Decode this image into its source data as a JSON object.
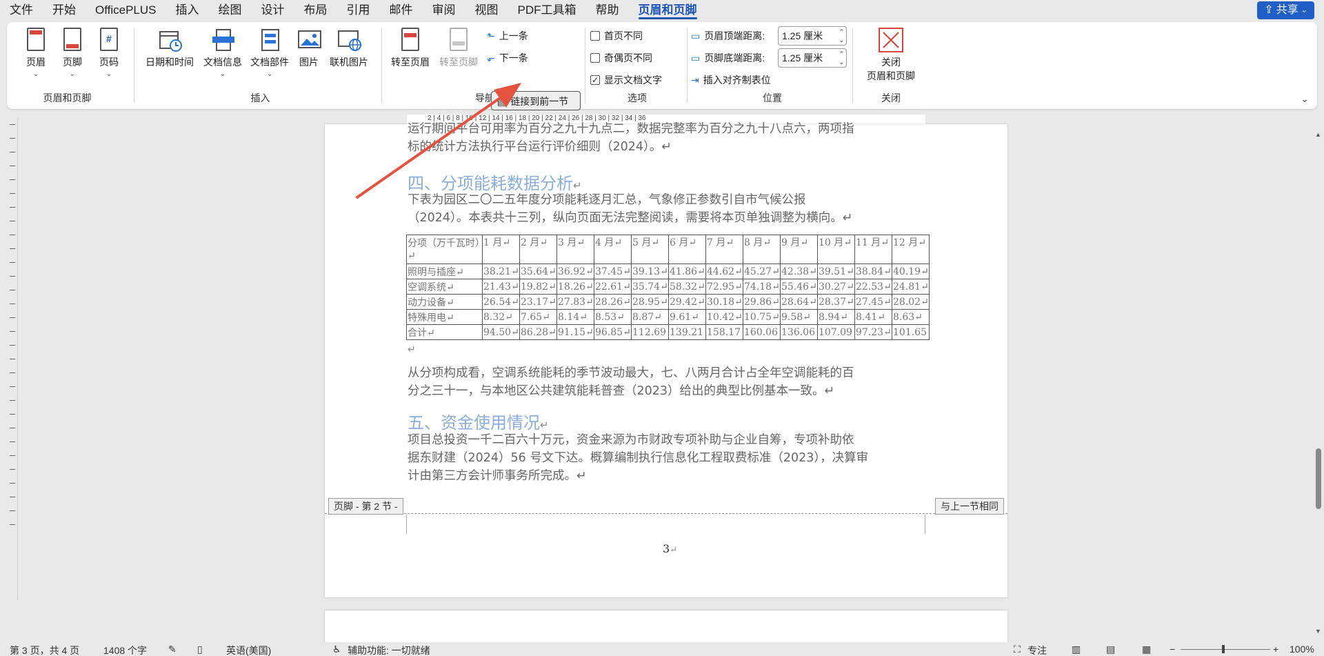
{
  "menu": {
    "items": [
      "文件",
      "开始",
      "OfficePLUS",
      "插入",
      "绘图",
      "设计",
      "布局",
      "引用",
      "邮件",
      "审阅",
      "视图",
      "PDF工具箱",
      "帮助",
      "页眉和页脚"
    ],
    "share": "共享"
  },
  "ribbon": {
    "hf_group": {
      "label": "页眉和页脚",
      "header": "页眉",
      "footer": "页脚",
      "pagenum": "页码"
    },
    "insert_group": {
      "label": "插入",
      "datetime": "日期和时间",
      "docinfo": "文档信息",
      "docparts": "文档部件",
      "picture": "图片",
      "online_picture": "联机图片"
    },
    "nav_group": {
      "label": "导航",
      "goto_header": "转至页眉",
      "goto_footer": "转至页脚",
      "prev": "上一条",
      "next": "下一条",
      "link_prev": "链接到前一节"
    },
    "options_group": {
      "label": "选项",
      "first_diff": "首页不同",
      "odd_even_diff": "奇偶页不同",
      "show_doc_text": "显示文档文字"
    },
    "position_group": {
      "label": "位置",
      "header_top": "页眉顶端距离:",
      "header_top_value": "1.25 厘米",
      "footer_bottom": "页脚底端距离:",
      "footer_bottom_value": "1.25 厘米",
      "insert_align_tab": "插入对齐制表位"
    },
    "close_group": {
      "label": "关闭",
      "close": "关闭",
      "close2": "页眉和页脚"
    }
  },
  "ruler": {
    "labels": "2 | 4 | 6 | 8 | 10 | 12 | 14 | 16 | 18 | 20 | 22 | 24 | 26 | 28 | 30 | 32 | 34 | 36"
  },
  "document": {
    "cut_top_1": "运行期间平台可用率为百分之九十九点二，数据完整率为百分之九十八点六，两项指",
    "cut_top_2": "标的统计方法执行平台运行评价细则（2024）。↵",
    "heading4": "四、分项能耗数据分析",
    "para_intro_1": "下表为园区二〇二五年度分项能耗逐月汇总，气象修正参数引自市气候公报",
    "para_intro_2": "（2024）。本表共十三列，纵向页面无法完整阅读，需要将本页单独调整为横向。↵",
    "table": {
      "header": [
        "分项（万千瓦时）↵",
        "1 月↵",
        "2 月↵",
        "3 月↵",
        "4 月↵",
        "5 月↵",
        "6 月↵",
        "7 月↵",
        "8 月↵",
        "9 月↵",
        "10 月↵",
        "11 月↵",
        "12 月↵"
      ],
      "rows": [
        [
          "照明与插座↵",
          "38.21↵",
          "35.64↵",
          "36.92↵",
          "37.45↵",
          "39.13↵",
          "41.86↵",
          "44.62↵",
          "45.27↵",
          "42.38↵",
          "39.51↵",
          "38.84↵",
          "40.19↵"
        ],
        [
          "空调系统↵",
          "21.43↵",
          "19.82↵",
          "18.26↵",
          "22.61↵",
          "35.74↵",
          "58.32↵",
          "72.95↵",
          "74.18↵",
          "55.46↵",
          "30.27↵",
          "22.53↵",
          "24.81↵"
        ],
        [
          "动力设备↵",
          "26.54↵",
          "23.17↵",
          "27.83↵",
          "28.26↵",
          "28.95↵",
          "29.42↵",
          "30.18↵",
          "29.86↵",
          "28.64↵",
          "28.37↵",
          "27.45↵",
          "28.02↵"
        ],
        [
          "特殊用电↵",
          "8.32↵",
          "7.65↵",
          "8.14↵",
          "8.53↵",
          "8.87↵",
          "9.61↵",
          "10.42↵",
          "10.75↵",
          "9.58↵",
          "8.94↵",
          "8.41↵",
          "8.63↵"
        ],
        [
          "合计↵",
          "94.50↵",
          "86.28↵",
          "91.15↵",
          "96.85↵",
          "112.69",
          "139.21",
          "158.17",
          "160.06",
          "136.06",
          "107.09",
          "97.23↵",
          "101.65"
        ]
      ]
    },
    "empty_para": "↵",
    "para_analysis_1": "从分项构成看，空调系统能耗的季节波动最大，七、八两月合计占全年空调能耗的百",
    "para_analysis_2": "分之三十一，与本地区公共建筑能耗普查（2023）给出的典型比例基本一致。↵",
    "heading5": "五、资金使用情况",
    "para_fund_1": "项目总投资一千二百六十万元，资金来源为市财政专项补助与企业自筹，专项补助依",
    "para_fund_2": "据东财建（2024）56 号文下达。概算编制执行信息化工程取费标准（2023），决算审",
    "para_fund_3": "计由第三方会计师事务所完成。↵",
    "footer_tag": "页脚 - 第 2 节 -",
    "same_as_prev": "与上一节相同",
    "page_number": "3"
  },
  "status": {
    "page": "第 3 页，共 4 页",
    "words": "1408 个字",
    "language": "英语(美国)",
    "accessibility": "辅助功能: 一切就绪",
    "focus": "专注",
    "zoom": "100%"
  },
  "colors": {
    "accent": "#1e56b8",
    "heading": "#8aaedb",
    "arrow": "#e5523f"
  }
}
